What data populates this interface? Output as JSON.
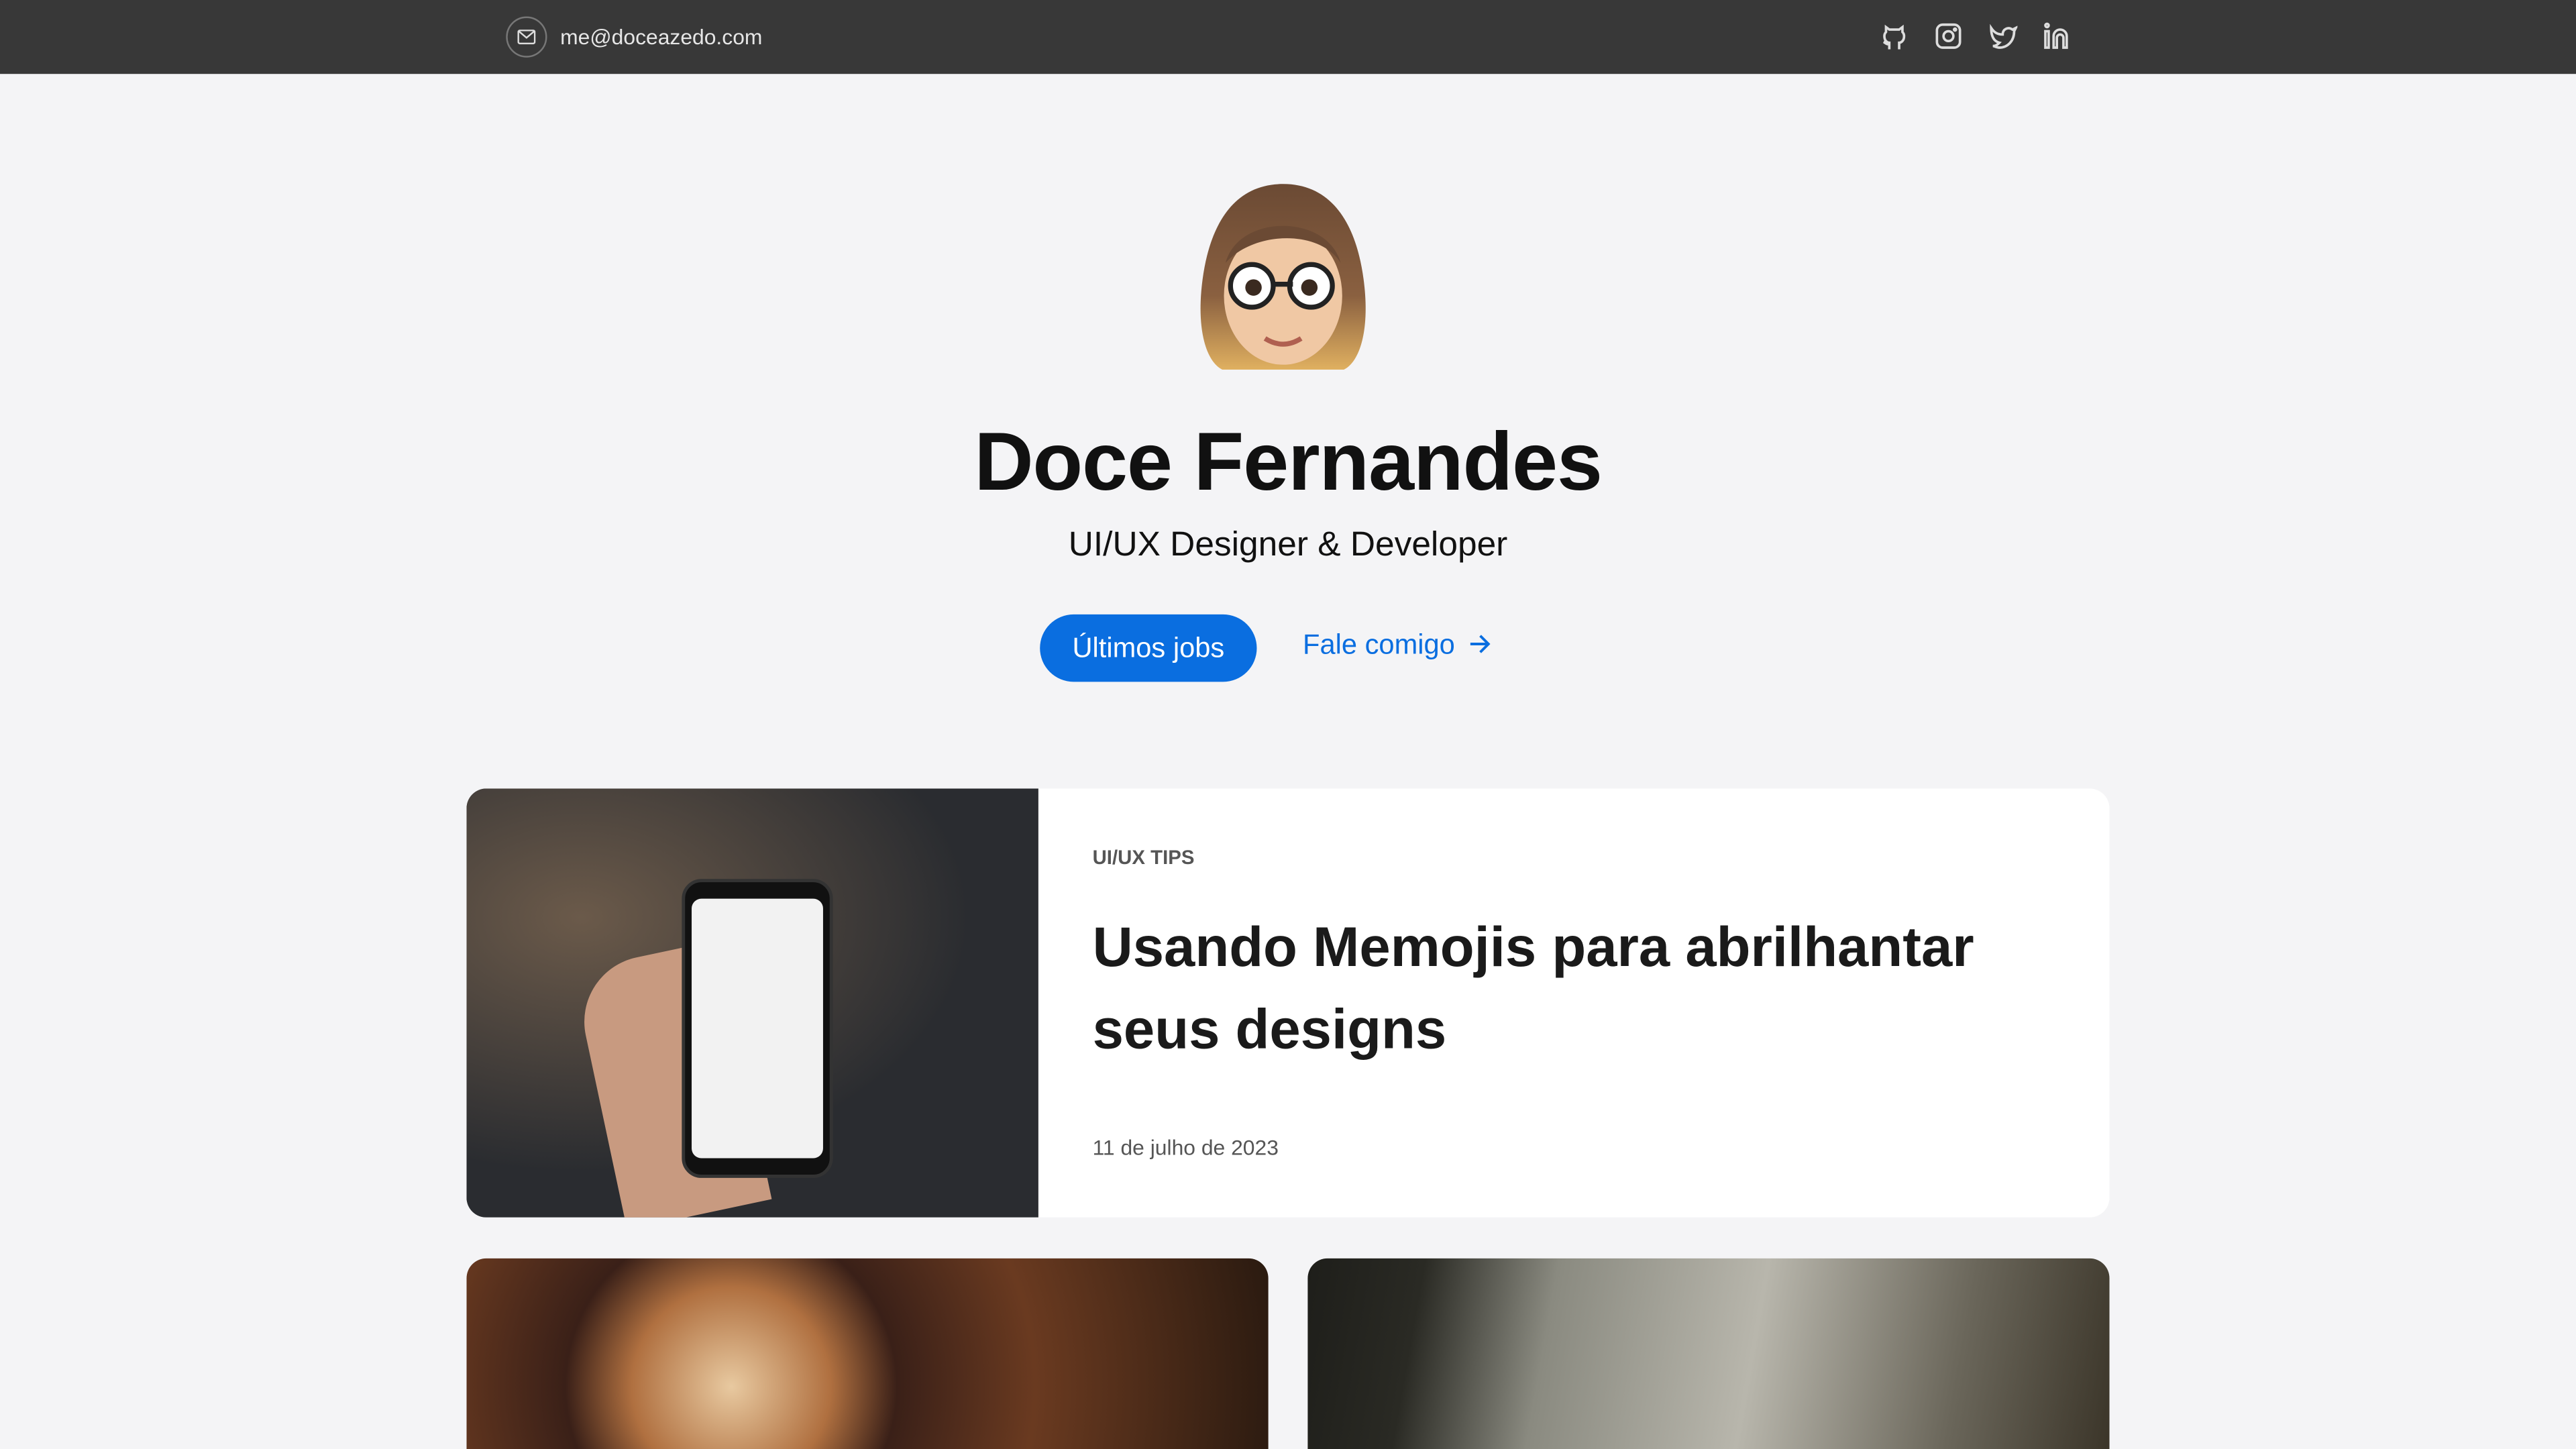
{
  "topbar": {
    "email": "me@doceazedo.com",
    "socials": [
      "github-icon",
      "instagram-icon",
      "twitter-icon",
      "linkedin-icon"
    ]
  },
  "hero": {
    "name": "Doce Fernandes",
    "subtitle": "UI/UX Designer & Developer",
    "primary_button": "Últimos jobs",
    "secondary_link": "Fale comigo"
  },
  "featured": {
    "category": "UI/UX TIPS",
    "title": "Usando Memojis para abrilhantar seus designs",
    "date": "11 de julho de 2023"
  },
  "colors": {
    "accent": "#0a6ee0",
    "topbar": "#383838",
    "background": "#f4f4f6"
  }
}
